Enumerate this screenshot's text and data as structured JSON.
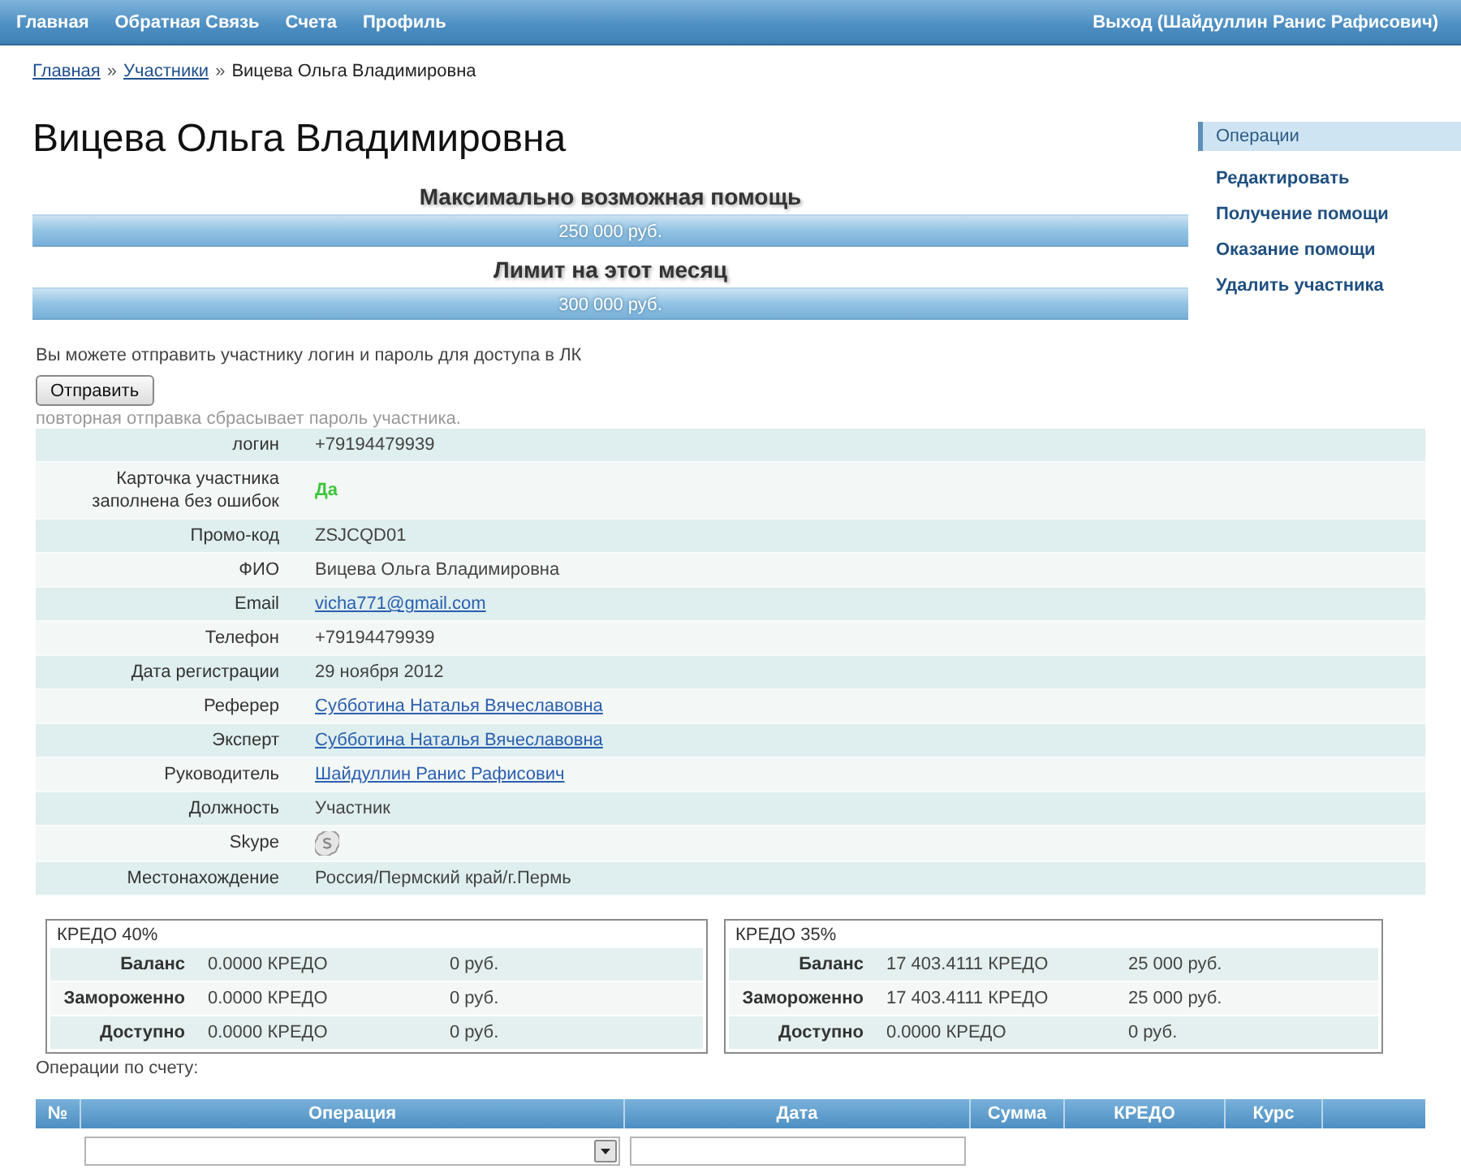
{
  "nav": {
    "items": [
      "Главная",
      "Обратная Связь",
      "Счета",
      "Профиль"
    ],
    "logout": "Выход (Шайдуллин Ранис Рафисович)"
  },
  "breadcrumb": [
    {
      "kind": "link",
      "label": "Главная"
    },
    {
      "kind": "separator",
      "label": "»"
    },
    {
      "kind": "link",
      "label": "Участники"
    },
    {
      "kind": "separator",
      "label": "»"
    },
    {
      "kind": "current",
      "label": "Вицева Ольга Владимировна"
    }
  ],
  "title": "Вицева Ольга Владимировна",
  "limits": [
    {
      "heading": "Максимально возможная помощь",
      "amount": "250 000 руб."
    },
    {
      "heading": "Лимит на этот месяц",
      "amount": "300 000 руб."
    }
  ],
  "sidebar": {
    "title": "Операции",
    "items": [
      "Редактировать",
      "Получение помощи",
      "Оказание помощи",
      "Удалить участника"
    ]
  },
  "send": {
    "hint": "Вы можете отправить участнику логин и пароль для доступа в ЛК",
    "button": "Отправить",
    "note": "повторная отправка сбрасывает пароль участника."
  },
  "profile": {
    "rows": [
      {
        "label": "логин",
        "kind": "text",
        "value": "+79194479939"
      },
      {
        "label": "Карточка участника заполнена без ошибок",
        "kind": "ok",
        "value": "Да"
      },
      {
        "label": "Промо-код",
        "kind": "text",
        "value": "ZSJCQD01"
      },
      {
        "label": "ФИО",
        "kind": "text",
        "value": "Вицева Ольга Владимировна"
      },
      {
        "label": "Email",
        "kind": "link",
        "value": "vicha771@gmail.com"
      },
      {
        "label": "Телефон",
        "kind": "text",
        "value": "+79194479939"
      },
      {
        "label": "Дата регистрации",
        "kind": "text",
        "value": "29 ноября 2012"
      },
      {
        "label": "Реферер",
        "kind": "link",
        "value": "Субботина Наталья Вячеславовна"
      },
      {
        "label": "Эксперт",
        "kind": "link",
        "value": "Субботина Наталья Вячеславовна"
      },
      {
        "label": "Руководитель",
        "kind": "link",
        "value": "Шайдуллин Ранис Рафисович"
      },
      {
        "label": "Должность",
        "kind": "text",
        "value": "Участник"
      },
      {
        "label": "Skype",
        "kind": "icon"
      },
      {
        "label": "Местонахождение",
        "kind": "text",
        "value": "Россия/Пермский край/г.Пермь"
      }
    ]
  },
  "accounts": [
    {
      "title": "КРЕДО 40%",
      "rows": [
        {
          "label": "Баланс",
          "credo": "0.0000 КРЕДО",
          "rub": "0 руб."
        },
        {
          "label": "Замороженно",
          "credo": "0.0000 КРЕДО",
          "rub": "0 руб."
        },
        {
          "label": "Доступно",
          "credo": "0.0000 КРЕДО",
          "rub": "0 руб."
        }
      ]
    },
    {
      "title": "КРЕДО 35%",
      "rows": [
        {
          "label": "Баланс",
          "credo": "17 403.4111 КРЕДО",
          "rub": "25 000 руб."
        },
        {
          "label": "Замороженно",
          "credo": "17 403.4111 КРЕДО",
          "rub": "25 000 руб."
        },
        {
          "label": "Доступно",
          "credo": "0.0000 КРЕДО",
          "rub": "0 руб."
        }
      ]
    }
  ],
  "operations": {
    "title": "Операции по счету:",
    "columns": [
      "№",
      "Операция",
      "Дата",
      "Сумма",
      "КРЕДО",
      "Курс"
    ],
    "filters": [
      {
        "kind": "select"
      },
      {
        "kind": "input"
      }
    ]
  }
}
